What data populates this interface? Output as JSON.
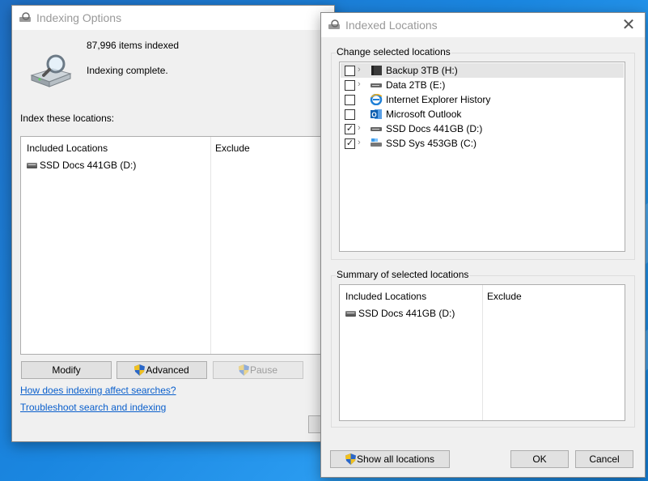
{
  "indexing_options": {
    "title": "Indexing Options",
    "items_indexed": "87,996 items indexed",
    "status": "Indexing complete.",
    "index_locations_label": "Index these locations:",
    "columns": {
      "included": "Included Locations",
      "exclude": "Exclude"
    },
    "included_items": [
      "SSD Docs 441GB (D:)"
    ],
    "buttons": {
      "modify": "Modify",
      "advanced": "Advanced",
      "pause": "Pause"
    },
    "links": {
      "how_affects": "How does indexing affect searches?",
      "troubleshoot": "Troubleshoot search and indexing"
    }
  },
  "indexed_locations": {
    "title": "Indexed Locations",
    "change_label": "Change selected locations",
    "tree": [
      {
        "label": "Backup 3TB (H:)",
        "checked": false,
        "expandable": true,
        "icon": "dark-drive-icon",
        "selected": true
      },
      {
        "label": "Data 2TB (E:)",
        "checked": false,
        "expandable": true,
        "icon": "drive-icon",
        "selected": false
      },
      {
        "label": "Internet Explorer History",
        "checked": false,
        "expandable": false,
        "icon": "ie-icon",
        "selected": false
      },
      {
        "label": "Microsoft Outlook",
        "checked": false,
        "expandable": false,
        "icon": "outlook-icon",
        "selected": false
      },
      {
        "label": "SSD Docs 441GB (D:)",
        "checked": true,
        "expandable": true,
        "icon": "drive-icon",
        "selected": false
      },
      {
        "label": "SSD Sys 453GB (C:)",
        "checked": true,
        "expandable": true,
        "icon": "system-drive-icon",
        "selected": false
      }
    ],
    "summary_label": "Summary of selected locations",
    "columns": {
      "included": "Included Locations",
      "exclude": "Exclude"
    },
    "included_items": [
      "SSD Docs 441GB (D:)"
    ],
    "buttons": {
      "show_all": "Show all locations",
      "ok": "OK",
      "cancel": "Cancel"
    },
    "close_glyph": "✕"
  },
  "glyphs": {
    "check": "✓",
    "chevron": "›"
  },
  "colors": {
    "link": "#0a5fcc",
    "desktop": "#1a86e0"
  }
}
